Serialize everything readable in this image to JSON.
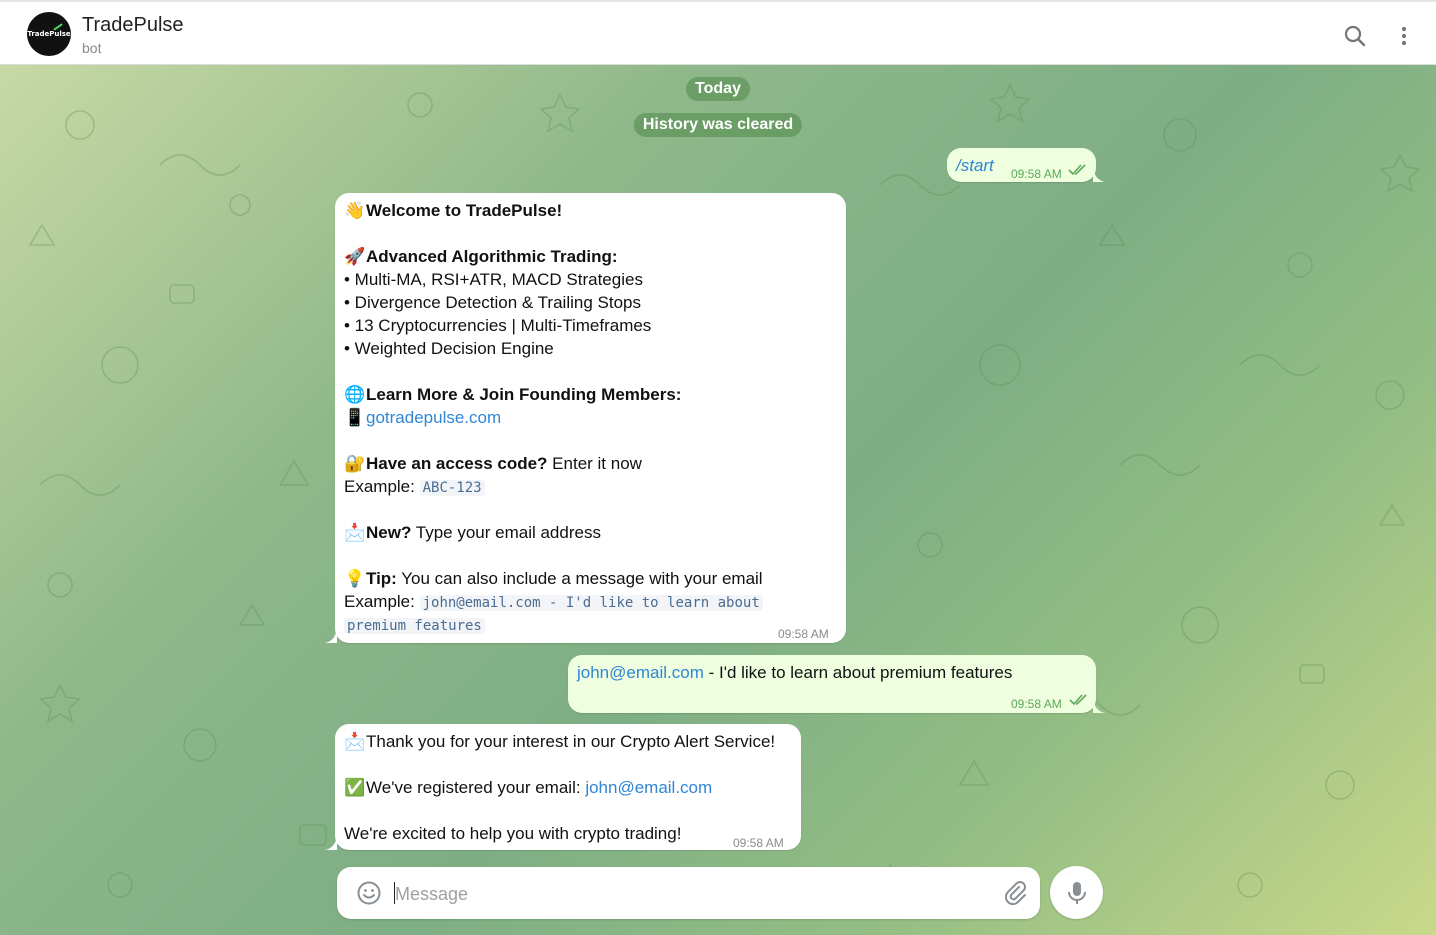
{
  "header": {
    "avatar_text": "TradePulse",
    "title": "TradePulse",
    "subtitle": "bot"
  },
  "chat": {
    "date_pill": "Today",
    "service_pill": "History was cleared",
    "messages": [
      {
        "direction": "out",
        "text": "/start",
        "time": "09:58 AM"
      },
      {
        "direction": "in",
        "time": "09:58 AM",
        "welcome": "Welcome to TradePulse!",
        "trading_heading": "Advanced Algorithmic Trading:",
        "bullets": [
          "• Multi-MA, RSI+ATR, MACD Strategies",
          "• Divergence Detection & Trailing Stops",
          "• 13 Cryptocurrencies | Multi-Timeframes",
          "• Weighted Decision Engine"
        ],
        "learn_heading": "Learn More & Join Founding Members:",
        "site_link": "gotradepulse.com",
        "access_bold": "Have an access code?",
        "access_rest": " Enter it now",
        "example_label": "Example: ",
        "access_example": "ABC-123",
        "new_bold": "New?",
        "new_rest": " Type your email address",
        "tip_bold": "Tip:",
        "tip_rest": " You can also include a message with your email",
        "tip_example_line1": "john@email.com - I'd like to learn about",
        "tip_example_line2": "premium features"
      },
      {
        "direction": "out",
        "time": "09:58 AM",
        "email_link": "john@email.com",
        "text_rest": " - I'd like to learn about premium features"
      },
      {
        "direction": "in",
        "time": "09:58 AM",
        "thanks": "Thank you for your interest in our Crypto Alert Service!",
        "registered": "We've registered your email: ",
        "registered_email": "john@email.com",
        "excited": "We're excited to help you with crypto trading!"
      }
    ]
  },
  "composer": {
    "placeholder": "Message"
  },
  "colors": {
    "outgoing_bubble": "#eefedf",
    "incoming_bubble": "#ffffff",
    "link": "#2f86d6",
    "read_check": "#5ea85a"
  }
}
